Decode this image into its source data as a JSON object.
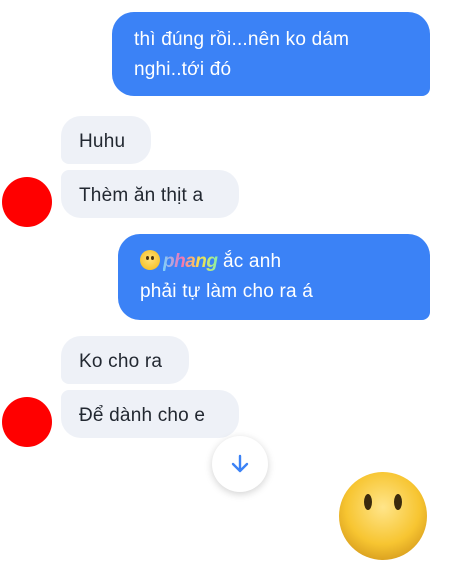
{
  "messages": [
    {
      "dir": "out",
      "lines": [
        "thì đúng rồi...nên ko dám",
        "nghi..tới đó"
      ]
    },
    {
      "dir": "in",
      "text": "Huhu"
    },
    {
      "dir": "in",
      "text": "Thèm ăn thịt a"
    },
    {
      "dir": "out",
      "watermark": "phang",
      "line1_tail": "ắc  anh",
      "line2": "phải tự làm cho ra á"
    },
    {
      "dir": "in",
      "text": "Ko cho ra"
    },
    {
      "dir": "in",
      "text": "Để dành cho e"
    }
  ],
  "icons": {
    "avatar": "red-circle-avatar",
    "scroll": "arrow-down-icon",
    "emoji": "smiley-emoji"
  },
  "colors": {
    "outgoing_bubble": "#3b82f6",
    "incoming_bubble": "#eef1f7",
    "avatar": "#ff0000",
    "scroll_arrow": "#3b82f6",
    "emoji": "#f7c531"
  }
}
